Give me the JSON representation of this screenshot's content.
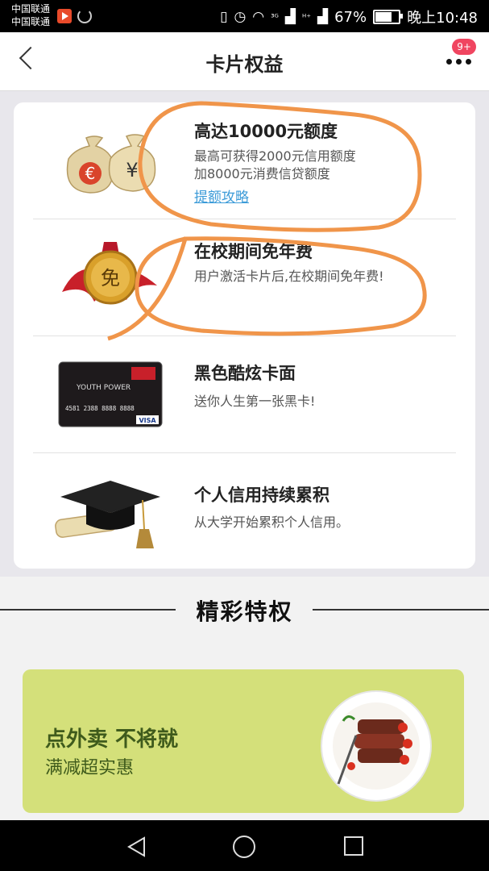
{
  "status_bar": {
    "carrier_1": "中国联通",
    "carrier_2": "中国联通",
    "signal_1": "³ᴳ",
    "signal_2": "ᴴ⁺",
    "battery_percent": "67%",
    "battery_level": 0.67,
    "time": "晚上10:48"
  },
  "nav": {
    "title": "卡片权益",
    "badge": "9+"
  },
  "benefits": [
    {
      "title": "高达10000元额度",
      "desc_1": "最高可获得2000元信用额度",
      "desc_2": "加8000元消费信贷额度",
      "link": "提额攻略",
      "icon": "money-bags-icon"
    },
    {
      "title": "在校期间免年费",
      "desc_1": "用户激活卡片后,在校期间免年费!",
      "icon": "medal-icon",
      "medal_text": "免"
    },
    {
      "title": "黑色酷炫卡面",
      "desc_1": "送你人生第一张黑卡!",
      "icon": "black-card-icon",
      "card_logo": "YOUTH POWER",
      "card_number": "4581 2388 8888 8888",
      "card_brand": "VISA"
    },
    {
      "title": "个人信用持续累积",
      "desc_1": "从大学开始累积个人信用。",
      "icon": "graduation-cap-icon"
    }
  ],
  "section": {
    "title": "精彩特权"
  },
  "promo": {
    "line_1": "点外卖 不将就",
    "line_2": "满减超实惠"
  },
  "colors": {
    "accent_link": "#3c9bd8",
    "badge": "#f04560",
    "banner_bg": "#d4e07a",
    "annotation": "#f0954a"
  }
}
